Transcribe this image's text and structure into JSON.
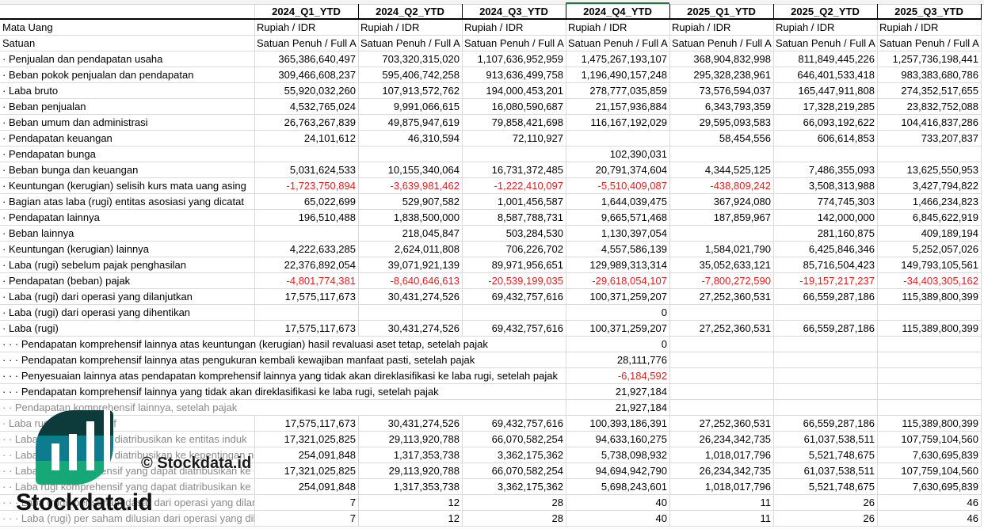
{
  "columns": [
    "2024_Q1_YTD",
    "2024_Q2_YTD",
    "2024_Q3_YTD",
    "2024_Q4_YTD",
    "2025_Q1_YTD",
    "2025_Q2_YTD",
    "2025_Q3_YTD"
  ],
  "currency": {
    "label": "Mata Uang",
    "values": [
      "Rupiah / IDR",
      "Rupiah / IDR",
      "Rupiah / IDR",
      "Rupiah / IDR",
      "Rupiah / IDR",
      "Rupiah / IDR",
      "Rupiah / IDR"
    ]
  },
  "unit": {
    "label": "Satuan",
    "values": [
      "Satuan Penuh / Full A",
      "Satuan Penuh / Full A",
      "Satuan Penuh / Full A",
      "Satuan Penuh / Full A",
      "Satuan Penuh / Full A",
      "Satuan Penuh / Full A",
      "Satuan Penuh / Full A"
    ]
  },
  "colors": {
    "negative": "#e0201f",
    "selected_column": "#217346",
    "logo_dark": "#0d3a3b",
    "logo_mid": "#0c7c8e",
    "logo_green": "#17a878"
  },
  "rows": [
    {
      "label": "· Penjualan dan pendapatan usaha",
      "values": [
        "365,386,640,497",
        "703,320,315,020",
        "1,107,636,952,959",
        "1,475,267,193,107",
        "368,904,832,998",
        "811,849,445,226",
        "1,257,736,198,441"
      ]
    },
    {
      "label": "· Beban pokok penjualan dan pendapatan",
      "values": [
        "309,466,608,237",
        "595,406,742,258",
        "913,636,499,758",
        "1,196,490,157,248",
        "295,328,238,961",
        "646,401,533,418",
        "983,383,680,786"
      ]
    },
    {
      "label": "· Laba bruto",
      "values": [
        "55,920,032,260",
        "107,913,572,762",
        "194,000,453,201",
        "278,777,035,859",
        "73,576,594,037",
        "165,447,911,808",
        "274,352,517,655"
      ]
    },
    {
      "label": "· Beban penjualan",
      "values": [
        "4,532,765,024",
        "9,991,066,615",
        "16,080,590,687",
        "21,157,936,884",
        "6,343,793,359",
        "17,328,219,285",
        "23,832,752,088"
      ]
    },
    {
      "label": "· Beban umum dan administrasi",
      "values": [
        "26,763,267,839",
        "49,875,947,619",
        "79,858,421,698",
        "116,167,192,029",
        "29,595,093,583",
        "66,093,192,622",
        "104,416,837,286"
      ]
    },
    {
      "label": "· Pendapatan keuangan",
      "values": [
        "24,101,612",
        "46,310,594",
        "72,110,927",
        "",
        "58,454,556",
        "606,614,853",
        "733,207,837"
      ]
    },
    {
      "label": "· Pendapatan bunga",
      "values": [
        "",
        "",
        "",
        "102,390,031",
        "",
        "",
        ""
      ]
    },
    {
      "label": "· Beban bunga dan keuangan",
      "values": [
        "5,031,624,533",
        "10,155,340,064",
        "16,731,372,485",
        "20,791,374,604",
        "4,344,525,125",
        "7,486,355,093",
        "13,625,550,953"
      ]
    },
    {
      "label": "· Keuntungan (kerugian) selisih kurs mata uang asing",
      "values": [
        "-1,723,750,894",
        "-3,639,981,462",
        "-1,222,410,097",
        "-5,510,409,087",
        "-438,809,242",
        "3,508,313,988",
        "3,427,794,822"
      ]
    },
    {
      "label": "· Bagian atas laba (rugi) entitas asosiasi yang dicatat",
      "values": [
        "65,022,699",
        "529,907,582",
        "1,001,456,587",
        "1,644,039,475",
        "367,924,080",
        "774,745,303",
        "1,466,234,823"
      ]
    },
    {
      "label": "· Pendapatan lainnya",
      "values": [
        "196,510,488",
        "1,838,500,000",
        "8,587,788,731",
        "9,665,571,468",
        "187,859,967",
        "142,000,000",
        "6,845,622,919"
      ]
    },
    {
      "label": "· Beban lainnya",
      "values": [
        "",
        "218,045,847",
        "503,284,530",
        "1,130,397,054",
        "",
        "281,160,875",
        "409,189,194"
      ]
    },
    {
      "label": "· Keuntungan (kerugian) lainnya",
      "values": [
        "4,222,633,285",
        "2,624,011,808",
        "706,226,702",
        "4,557,586,139",
        "1,584,021,790",
        "6,425,846,346",
        "5,252,057,026"
      ]
    },
    {
      "label": "· Laba (rugi) sebelum pajak penghasilan",
      "values": [
        "22,376,892,054",
        "39,071,921,139",
        "89,971,956,651",
        "129,989,313,314",
        "35,052,633,121",
        "85,716,504,423",
        "149,793,105,561"
      ]
    },
    {
      "label": "· Pendapatan (beban) pajak",
      "values": [
        "-4,801,774,381",
        "-8,640,646,613",
        "-20,539,199,035",
        "-29,618,054,107",
        "-7,800,272,590",
        "-19,157,217,237",
        "-34,403,305,162"
      ]
    },
    {
      "label": "· Laba (rugi) dari operasi yang dilanjutkan",
      "values": [
        "17,575,117,673",
        "30,431,274,526",
        "69,432,757,616",
        "100,371,259,207",
        "27,252,360,531",
        "66,559,287,186",
        "115,389,800,399"
      ]
    },
    {
      "label": "· Laba (rugi) dari operasi yang dihentikan",
      "values": [
        "",
        "",
        "",
        "0",
        "",
        "",
        ""
      ]
    },
    {
      "label": "· Laba (rugi)",
      "values": [
        "17,575,117,673",
        "30,431,274,526",
        "69,432,757,616",
        "100,371,259,207",
        "27,252,360,531",
        "66,559,287,186",
        "115,389,800,399"
      ]
    },
    {
      "label": "· · · Pendapatan komprehensif lainnya atas keuntungan (kerugian) hasil revaluasi aset tetap, setelah pajak",
      "spill": true,
      "values": [
        "",
        "",
        "",
        "0",
        "",
        "",
        ""
      ]
    },
    {
      "label": "· · · Pendapatan komprehensif lainnya atas pengukuran kembali kewajiban manfaat pasti, setelah pajak",
      "spill": true,
      "values": [
        "",
        "",
        "",
        "28,111,776",
        "",
        "",
        ""
      ]
    },
    {
      "label": "· · · Penyesuaian lainnya atas pendapatan komprehensif lainnya yang tidak akan direklasifikasi ke laba rugi, setelah pajak",
      "spill": true,
      "values": [
        "",
        "",
        "",
        "-6,184,592",
        "",
        "",
        ""
      ]
    },
    {
      "label": "· · · Pendapatan komprehensif lainnya yang tidak akan direklasifikasi ke laba rugi, setelah pajak",
      "spill": true,
      "values": [
        "",
        "",
        "",
        "21,927,184",
        "",
        "",
        ""
      ]
    },
    {
      "label": "· · Pendapatan komprehensif lainnya, setelah pajak",
      "spill": true,
      "gray": true,
      "values": [
        "",
        "",
        "",
        "21,927,184",
        "",
        "",
        ""
      ]
    },
    {
      "label": "· Laba rugi komprehensif",
      "gray": true,
      "values": [
        "17,575,117,673",
        "30,431,274,526",
        "69,432,757,616",
        "100,393,186,391",
        "27,252,360,531",
        "66,559,287,186",
        "115,389,800,399"
      ]
    },
    {
      "label": "· · Laba rugi yang dapat diatribusikan ke entitas induk",
      "gray": true,
      "values": [
        "17,321,025,825",
        "29,113,920,788",
        "66,070,582,254",
        "94,633,160,275",
        "26,234,342,735",
        "61,037,538,511",
        "107,759,104,560"
      ]
    },
    {
      "label": "· · Laba rugi yang dapat diatribusikan ke kepentingan non-pengendali",
      "gray": true,
      "values": [
        "254,091,848",
        "1,317,353,738",
        "3,362,175,362",
        "5,738,098,932",
        "1,018,017,796",
        "5,521,748,675",
        "7,630,695,839"
      ]
    },
    {
      "label": "· · Laba rugi komprehensif yang dapat diatribusikan ke entitas induk",
      "gray": true,
      "values": [
        "17,321,025,825",
        "29,113,920,788",
        "66,070,582,254",
        "94,694,942,790",
        "26,234,342,735",
        "61,037,538,511",
        "107,759,104,560"
      ]
    },
    {
      "label": "· · Laba rugi komprehensif yang dapat diatribusikan ke kepentingan non-pengendali",
      "gray": true,
      "values": [
        "254,091,848",
        "1,317,353,738",
        "3,362,175,362",
        "5,698,243,601",
        "1,018,017,796",
        "5,521,748,675",
        "7,630,695,839"
      ]
    },
    {
      "label": "· · · Laba (rugi) per saham dasar dari operasi yang dilanjutkan",
      "gray": true,
      "values": [
        "7",
        "12",
        "28",
        "40",
        "11",
        "26",
        "46"
      ]
    },
    {
      "label": "· · · Laba (rugi) per saham dilusian dari operasi yang dilanjutkan",
      "gray": true,
      "values": [
        "7",
        "12",
        "28",
        "40",
        "11",
        "26",
        "46"
      ]
    }
  ],
  "watermark": {
    "small": "© Stockdata.id",
    "big": "Stockdata.id"
  }
}
